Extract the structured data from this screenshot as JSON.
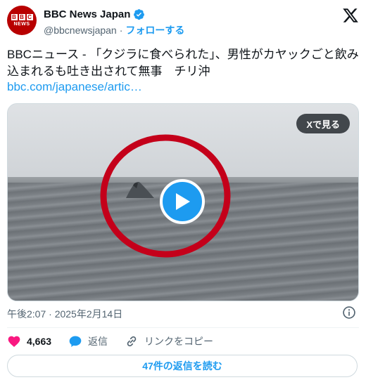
{
  "author": {
    "display_name": "BBC News Japan",
    "handle": "@bbcnewsjapan",
    "separator": "·",
    "follow_label": "フォローする",
    "avatar_blocks": [
      "B",
      "B",
      "C"
    ],
    "avatar_word": "NEWS"
  },
  "post": {
    "text": "BBCニュース - 「クジラに食べられた」、男性がカヤックごと飲み込まれるも吐き出されて無事　チリ沖",
    "link": "bbc.com/japanese/artic…"
  },
  "media": {
    "view_on_x_label": "Xで見る"
  },
  "meta": {
    "timestamp": "午後2:07 · 2025年2月14日"
  },
  "actions": {
    "likes": "4,663",
    "reply_label": "返信",
    "copy_link_label": "リンクをコピー"
  },
  "replies_button": "47件の返信を読む",
  "colors": {
    "accent": "#1d9bf0",
    "like": "#f91880",
    "brand": "#b80000",
    "circle": "#c4001a"
  }
}
